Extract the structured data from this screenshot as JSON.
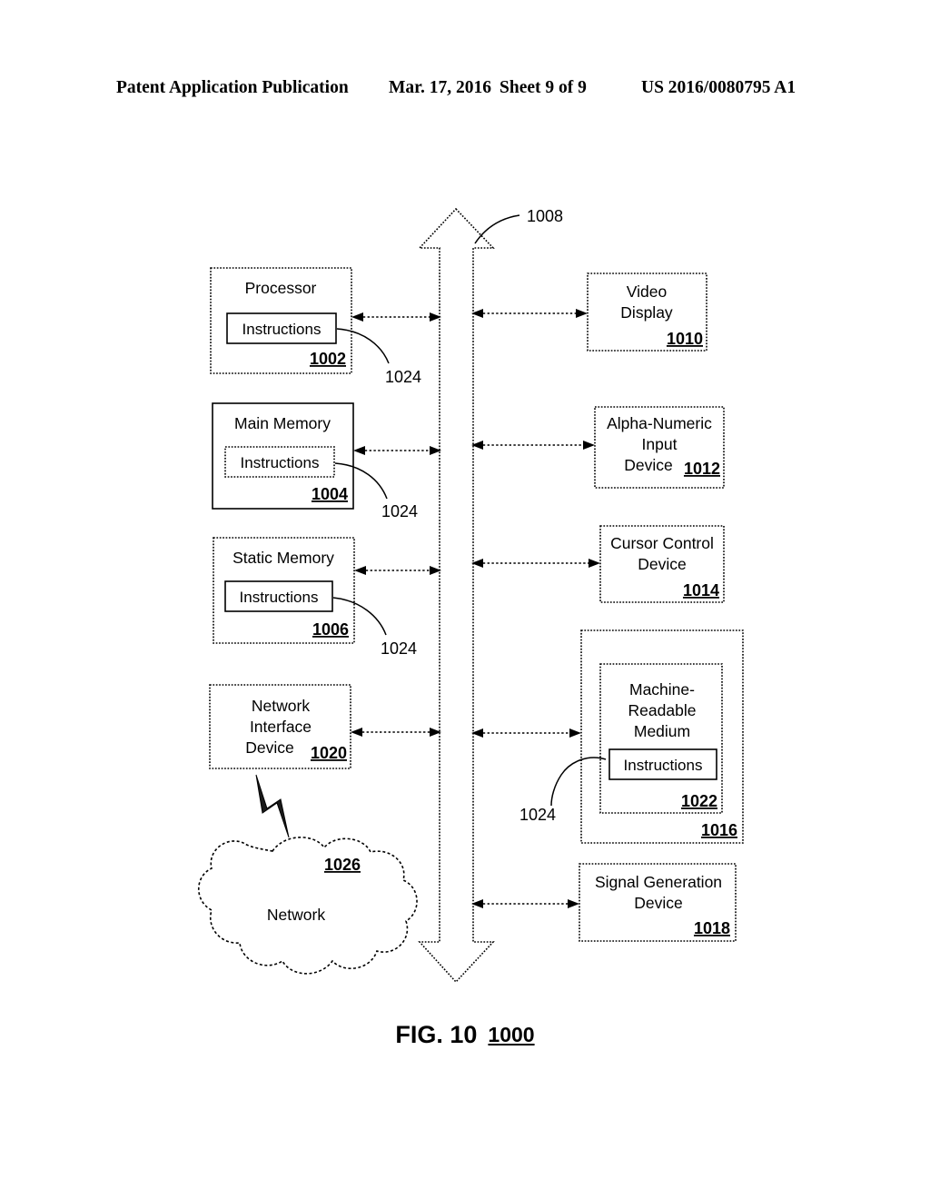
{
  "header": {
    "left": "Patent Application Publication",
    "date": "Mar. 17, 2016",
    "sheet": "Sheet 9 of 9",
    "patent_number": "US 2016/0080795 A1"
  },
  "figure": {
    "caption": "FIG. 10",
    "caption_ref": "1000"
  },
  "bus": {
    "label": "1008",
    "name": "bus"
  },
  "instructions_label": "Instructions",
  "instruction_leader_label": "1024",
  "left_blocks": [
    {
      "title": "Processor",
      "ref": "1002",
      "inner_label": "Instructions",
      "leader_ref": "1024"
    },
    {
      "title": "Main Memory",
      "ref": "1004",
      "inner_label": "Instructions",
      "leader_ref": "1024"
    },
    {
      "title": "Static Memory",
      "ref": "1006",
      "inner_label": "Instructions",
      "leader_ref": "1024"
    },
    {
      "title_lines": [
        "Network",
        "Interface",
        "Device"
      ],
      "ref": "1020"
    }
  ],
  "right_blocks": [
    {
      "title_lines": [
        "Video",
        "Display"
      ],
      "ref": "1010"
    },
    {
      "title_lines": [
        "Alpha-Numeric",
        "Input",
        "Device"
      ],
      "ref": "1012"
    },
    {
      "title_lines": [
        "Cursor Control",
        "Device"
      ],
      "ref": "1014"
    },
    {
      "outer_ref": "1016",
      "medium_lines": [
        "Machine-",
        "Readable",
        "Medium"
      ],
      "medium_ref": "1022",
      "inner_label": "Instructions",
      "leader_ref": "1024"
    },
    {
      "title_lines": [
        "Signal Generation",
        "Device"
      ],
      "ref": "1018"
    }
  ],
  "network": {
    "label": "Network",
    "ref": "1026"
  },
  "colors": {
    "ink": "#000000",
    "paper": "#ffffff"
  }
}
